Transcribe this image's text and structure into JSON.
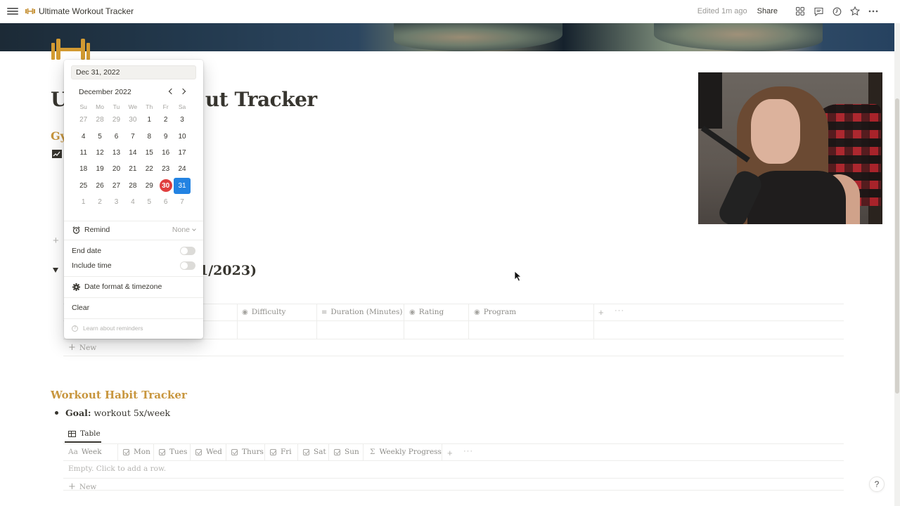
{
  "topbar": {
    "breadcrumb": "Ultimate Workout Tracker",
    "edited": "Edited 1m ago",
    "share": "Share",
    "icons": [
      "layout-icon",
      "comment-icon",
      "history-icon",
      "star-icon",
      "more-icon"
    ]
  },
  "page": {
    "title": "Ultimate Workout Tracker",
    "title_visible_left": "U",
    "title_visible_right": "ut Tracker",
    "gy_heading": "Gy",
    "sidebar_links": [
      "chart-icon",
      "head-icon",
      "dumbbell-icon",
      "archive-icon"
    ],
    "section_title_visible": "1/2023)",
    "accent_color": "#c8963e"
  },
  "workout_table": {
    "columns": [
      {
        "label": "Difficulty",
        "icon": "select-icon"
      },
      {
        "label": "Duration (Minutes)",
        "icon": "text-icon"
      },
      {
        "label": "Rating",
        "icon": "select-icon"
      },
      {
        "label": "Program",
        "icon": "select-icon"
      }
    ],
    "new_label": "New"
  },
  "habit": {
    "heading": "Workout Habit Tracker",
    "goal_label": "Goal:",
    "goal_text": "workout 5x/week",
    "view_tab": "Table",
    "columns": [
      {
        "label": "Week",
        "icon": "Aa"
      },
      {
        "label": "Mon",
        "icon": "checkbox"
      },
      {
        "label": "Tues",
        "icon": "checkbox"
      },
      {
        "label": "Wed",
        "icon": "checkbox"
      },
      {
        "label": "Thurs",
        "icon": "checkbox"
      },
      {
        "label": "Fri",
        "icon": "checkbox"
      },
      {
        "label": "Sat",
        "icon": "checkbox"
      },
      {
        "label": "Sun",
        "icon": "checkbox"
      },
      {
        "label": "Weekly Progress",
        "icon": "Σ"
      }
    ],
    "empty_text": "Empty. Click to add a row.",
    "new_label": "New"
  },
  "date_picker": {
    "input_value": "Dec 31, 2022",
    "month_label": "December 2022",
    "weekdays": [
      "Su",
      "Mo",
      "Tu",
      "We",
      "Th",
      "Fr",
      "Sa"
    ],
    "weeks": [
      [
        {
          "d": "27",
          "o": true
        },
        {
          "d": "28",
          "o": true
        },
        {
          "d": "29",
          "o": true
        },
        {
          "d": "30",
          "o": true
        },
        {
          "d": "1"
        },
        {
          "d": "2"
        },
        {
          "d": "3"
        }
      ],
      [
        {
          "d": "4"
        },
        {
          "d": "5"
        },
        {
          "d": "6"
        },
        {
          "d": "7"
        },
        {
          "d": "8"
        },
        {
          "d": "9"
        },
        {
          "d": "10"
        }
      ],
      [
        {
          "d": "11"
        },
        {
          "d": "12"
        },
        {
          "d": "13"
        },
        {
          "d": "14"
        },
        {
          "d": "15"
        },
        {
          "d": "16"
        },
        {
          "d": "17"
        }
      ],
      [
        {
          "d": "18"
        },
        {
          "d": "19"
        },
        {
          "d": "20"
        },
        {
          "d": "21"
        },
        {
          "d": "22"
        },
        {
          "d": "23"
        },
        {
          "d": "24"
        }
      ],
      [
        {
          "d": "25"
        },
        {
          "d": "26"
        },
        {
          "d": "27"
        },
        {
          "d": "28"
        },
        {
          "d": "29"
        },
        {
          "d": "30",
          "today": true
        },
        {
          "d": "31",
          "selected": true
        }
      ],
      [
        {
          "d": "1",
          "o": true
        },
        {
          "d": "2",
          "o": true
        },
        {
          "d": "3",
          "o": true
        },
        {
          "d": "4",
          "o": true
        },
        {
          "d": "5",
          "o": true
        },
        {
          "d": "6",
          "o": true
        },
        {
          "d": "7",
          "o": true
        }
      ]
    ],
    "today_color": "#e03e3e",
    "selected_color": "#2383e2",
    "remind_label": "Remind",
    "remind_value": "None",
    "end_date_label": "End date",
    "end_date_on": false,
    "include_time_label": "Include time",
    "include_time_on": false,
    "date_format_label": "Date format & timezone",
    "clear_label": "Clear",
    "learn_label": "Learn about reminders"
  },
  "help_label": "?"
}
